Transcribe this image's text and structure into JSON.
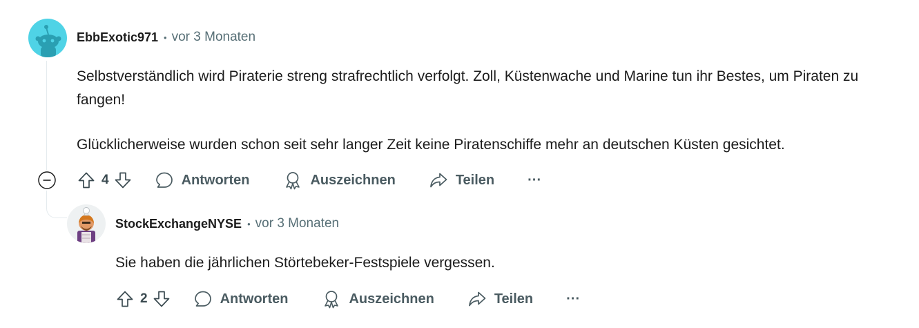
{
  "comments": [
    {
      "author": "EbbExotic971",
      "separator": "•",
      "time": "vor 3 Monaten",
      "paragraphs": [
        "Selbstverständlich wird Piraterie streng strafrechtlich verfolgt. Zoll, Küstenwache und Marine tun ihr Bestes, um Piraten zu fangen!",
        "Glücklicherweise wurden schon seit sehr langer Zeit keine Piratenschiffe mehr an deutschen Küsten gesichtet."
      ],
      "score": "4",
      "actions": {
        "reply": "Antworten",
        "award": "Auszeichnen",
        "share": "Teilen",
        "more": "···"
      }
    },
    {
      "author": "StockExchangeNYSE",
      "separator": "•",
      "time": "vor 3 Monaten",
      "paragraphs": [
        "Sie haben die jährlichen Störtebeker-Festspiele vergessen."
      ],
      "score": "2",
      "actions": {
        "reply": "Antworten",
        "award": "Auszeichnen",
        "share": "Teilen",
        "more": "···"
      }
    }
  ],
  "icons": {
    "collapse": "collapse-minus-icon",
    "upvote": "arrow-up-outline-icon",
    "downvote": "arrow-down-outline-icon",
    "reply": "speech-bubble-icon",
    "award": "award-ribbon-icon",
    "share": "share-arrow-icon",
    "more": "ellipsis-icon"
  },
  "colors": {
    "avatar_bg_1": "#4fd3e6",
    "meta_gray": "#576f76",
    "action_gray": "#4a5b61",
    "thread_line": "#e5ebee"
  }
}
